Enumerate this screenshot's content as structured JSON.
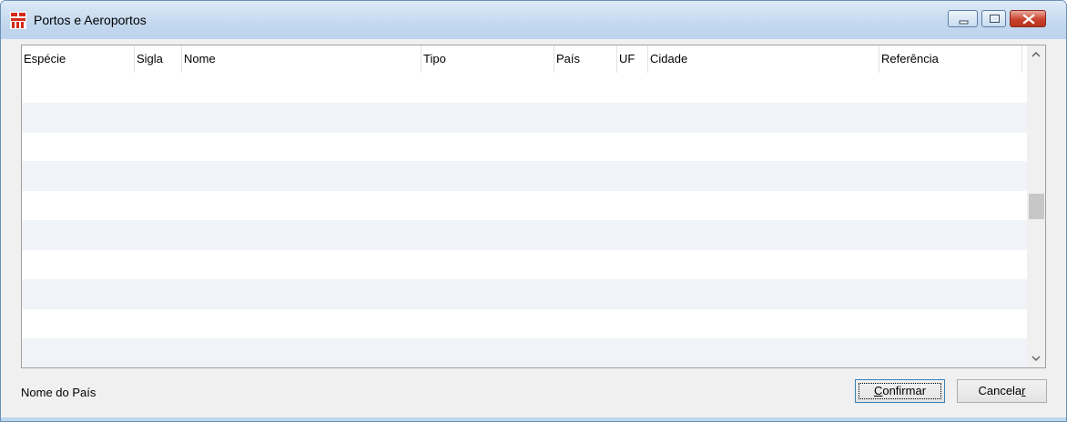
{
  "window": {
    "title": "Portos e Aeroportos",
    "controls": {
      "minimize": "minimize-icon",
      "maximize": "maximize-icon",
      "close": "close-icon"
    }
  },
  "table": {
    "columns": [
      "Espécie",
      "Sigla",
      "Nome",
      "Tipo",
      "País",
      "UF",
      "Cidade",
      "Referência"
    ],
    "rows": []
  },
  "status_text": "Nome do País",
  "buttons": {
    "confirm": {
      "mnemonic": "C",
      "rest": "onfirmar"
    },
    "cancel": {
      "lead": "Cancela",
      "mnemonic": "r"
    }
  },
  "colors": {
    "close_button": "#c9432e",
    "alt_row": "#f0f3f8",
    "title_bar": "#c3d8ef"
  }
}
